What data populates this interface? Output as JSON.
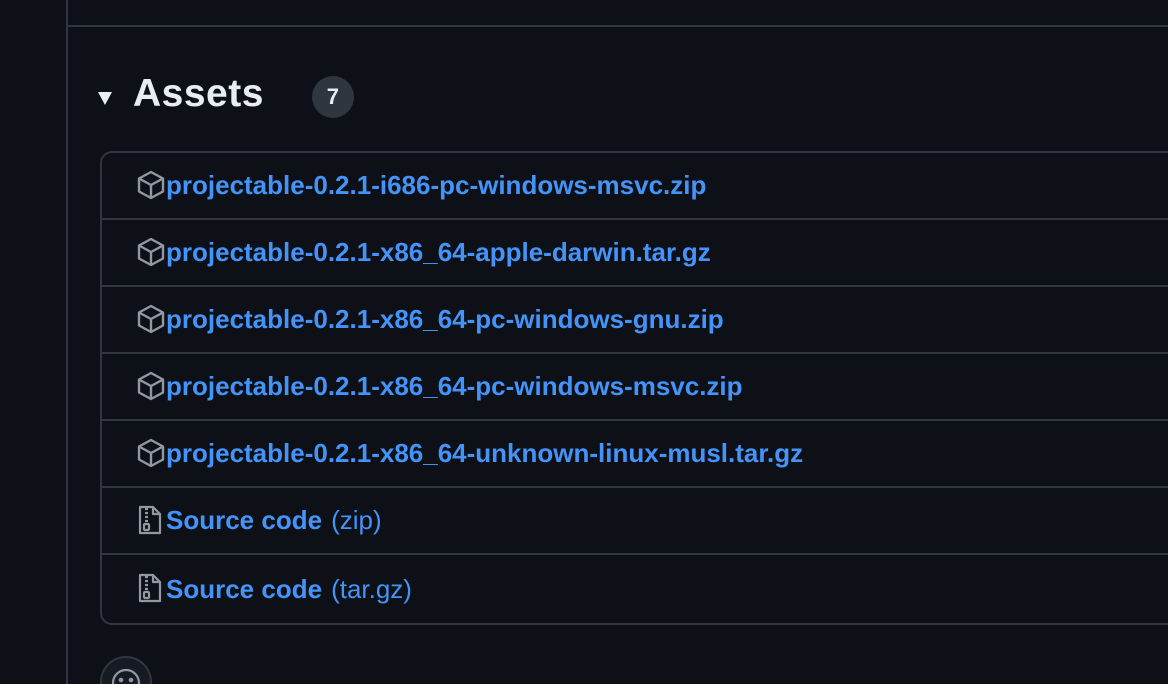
{
  "assets": {
    "title": "Assets",
    "count": "7",
    "items": [
      {
        "name": "projectable-0.2.1-i686-pc-windows-msvc.zip",
        "suffix": "",
        "icon": "package-icon"
      },
      {
        "name": "projectable-0.2.1-x86_64-apple-darwin.tar.gz",
        "suffix": "",
        "icon": "package-icon"
      },
      {
        "name": "projectable-0.2.1-x86_64-pc-windows-gnu.zip",
        "suffix": "",
        "icon": "package-icon"
      },
      {
        "name": "projectable-0.2.1-x86_64-pc-windows-msvc.zip",
        "suffix": "",
        "icon": "package-icon"
      },
      {
        "name": "projectable-0.2.1-x86_64-unknown-linux-musl.tar.gz",
        "suffix": "",
        "icon": "package-icon"
      },
      {
        "name": "Source code",
        "suffix": "(zip)",
        "icon": "file-zip-icon"
      },
      {
        "name": "Source code",
        "suffix": "(tar.gz)",
        "icon": "file-zip-icon"
      }
    ]
  },
  "colors": {
    "background": "#0d1117",
    "border": "#30363d",
    "link": "#4493f8",
    "text": "#e6edf3",
    "icon": "#9198a1"
  }
}
